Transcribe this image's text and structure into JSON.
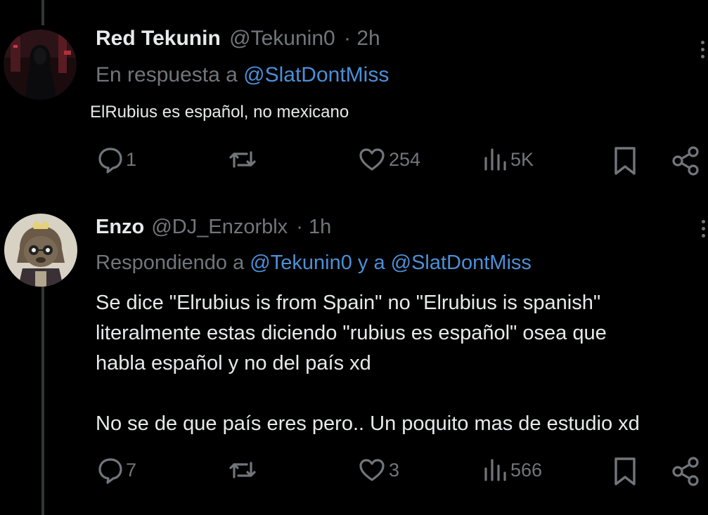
{
  "posts": [
    {
      "name": "Red Tekunin",
      "handle": "@Tekunin0",
      "separator": "·",
      "time": "2h",
      "reply_prefix": "En respuesta a",
      "reply_to": "@SlatDontMiss",
      "text": "ElRubius es español, no mexicano",
      "actions": {
        "replies": "1",
        "likes": "254",
        "views": "5K"
      },
      "icons": [
        "comment-icon",
        "retweet-icon",
        "heart-icon",
        "views-icon",
        "bookmark-icon",
        "share-icon"
      ]
    },
    {
      "name": "Enzo",
      "handle": "@DJ_Enzorblx",
      "separator": "·",
      "time": "1h",
      "reply_prefix": "Respondiendo a",
      "reply_to_1": "@Tekunin0",
      "reply_join": "y a",
      "reply_to_2": "@SlatDontMiss",
      "text_lines": [
        "Se dice \"Elrubius is from Spain\" no \"Elrubius is spanish\"",
        "literalmente estas diciendo \"rubius es español\" osea que",
        "habla español y no del país xd",
        "No se de que país eres pero.. Un poquito mas de estudio xd"
      ],
      "actions": {
        "replies": "7",
        "likes": "3",
        "views": "566"
      }
    }
  ],
  "colors": {
    "background": "#000000",
    "text": "#e7e9ea",
    "muted": "#71767b",
    "link": "#4c8fd6"
  }
}
